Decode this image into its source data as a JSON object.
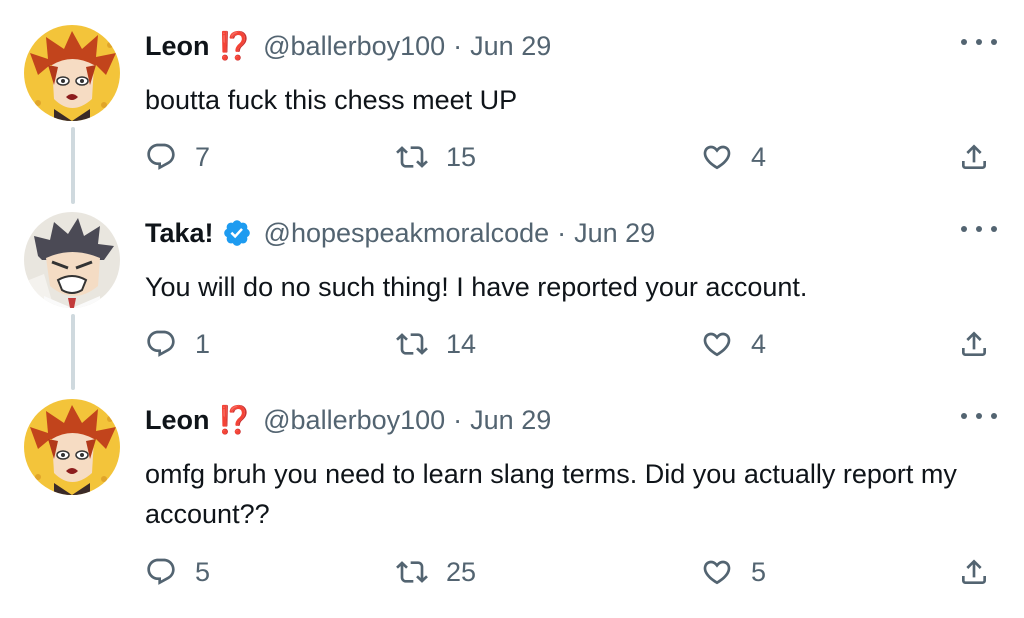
{
  "tweets": [
    {
      "name": "Leon",
      "name_emoji": "⁉️",
      "verified": false,
      "handle": "@ballerboy100",
      "separator": "·",
      "date": "Jun 29",
      "text": "boutta fuck this chess meet UP",
      "replies": "7",
      "retweets": "15",
      "likes": "4"
    },
    {
      "name": "Taka!",
      "name_emoji": "",
      "verified": true,
      "handle": "@hopespeakmoralcode",
      "separator": "·",
      "date": "Jun 29",
      "text": "You will do no such thing! I have reported your account.",
      "replies": "1",
      "retweets": "14",
      "likes": "4"
    },
    {
      "name": "Leon",
      "name_emoji": "⁉️",
      "verified": false,
      "handle": "@ballerboy100",
      "separator": "·",
      "date": "Jun 29",
      "text": "omfg bruh you need to learn slang terms. Did you actually report my account??",
      "replies": "5",
      "retweets": "25",
      "likes": "5"
    }
  ],
  "colors": {
    "text": "#0f1419",
    "secondary": "#536471",
    "thread_line": "#cfd9de",
    "verified_blue": "#1d9bf0",
    "interrobang_red": "#d92b2b"
  },
  "icons": {
    "reply": "reply-icon",
    "retweet": "retweet-icon",
    "like": "heart-icon",
    "share": "share-icon",
    "more": "more-icon",
    "verified": "verified-badge-icon"
  }
}
